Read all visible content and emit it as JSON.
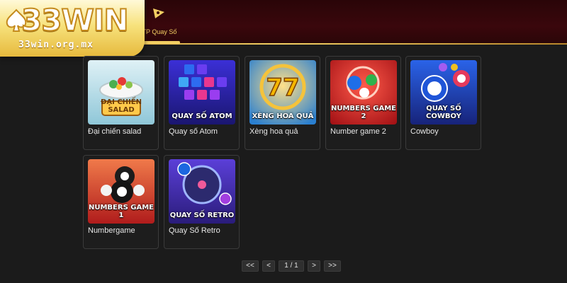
{
  "logo": {
    "wordmark": "33WIN",
    "domain": "33win.org.mx"
  },
  "nav": {
    "active_tab_label": "TP Quay Số",
    "active_tab_icon": "lottery-ticket-icon",
    "accent": "#f3cf63"
  },
  "games": [
    {
      "title": "Đại chiến salad",
      "thumb_caption": "ĐẠI CHIẾN SALAD"
    },
    {
      "title": "Quay số Atom",
      "thumb_caption": "QUAY SỐ ATOM"
    },
    {
      "title": "Xèng hoa quả",
      "thumb_caption": "XÈNG HOA QUẢ"
    },
    {
      "title": "Number game 2",
      "thumb_caption": "NUMBERS GAME 2"
    },
    {
      "title": "Cowboy",
      "thumb_caption": "QUAY SỐ COWBOY"
    },
    {
      "title": "Numbergame",
      "thumb_caption": "NUMBERS GAME 1"
    },
    {
      "title": "Quay Số Retro",
      "thumb_caption": "QUAY SỐ RETRO"
    }
  ],
  "pagination": {
    "first": "<<",
    "prev": "<",
    "current": "1 / 1",
    "next": ">",
    "last": ">>"
  }
}
